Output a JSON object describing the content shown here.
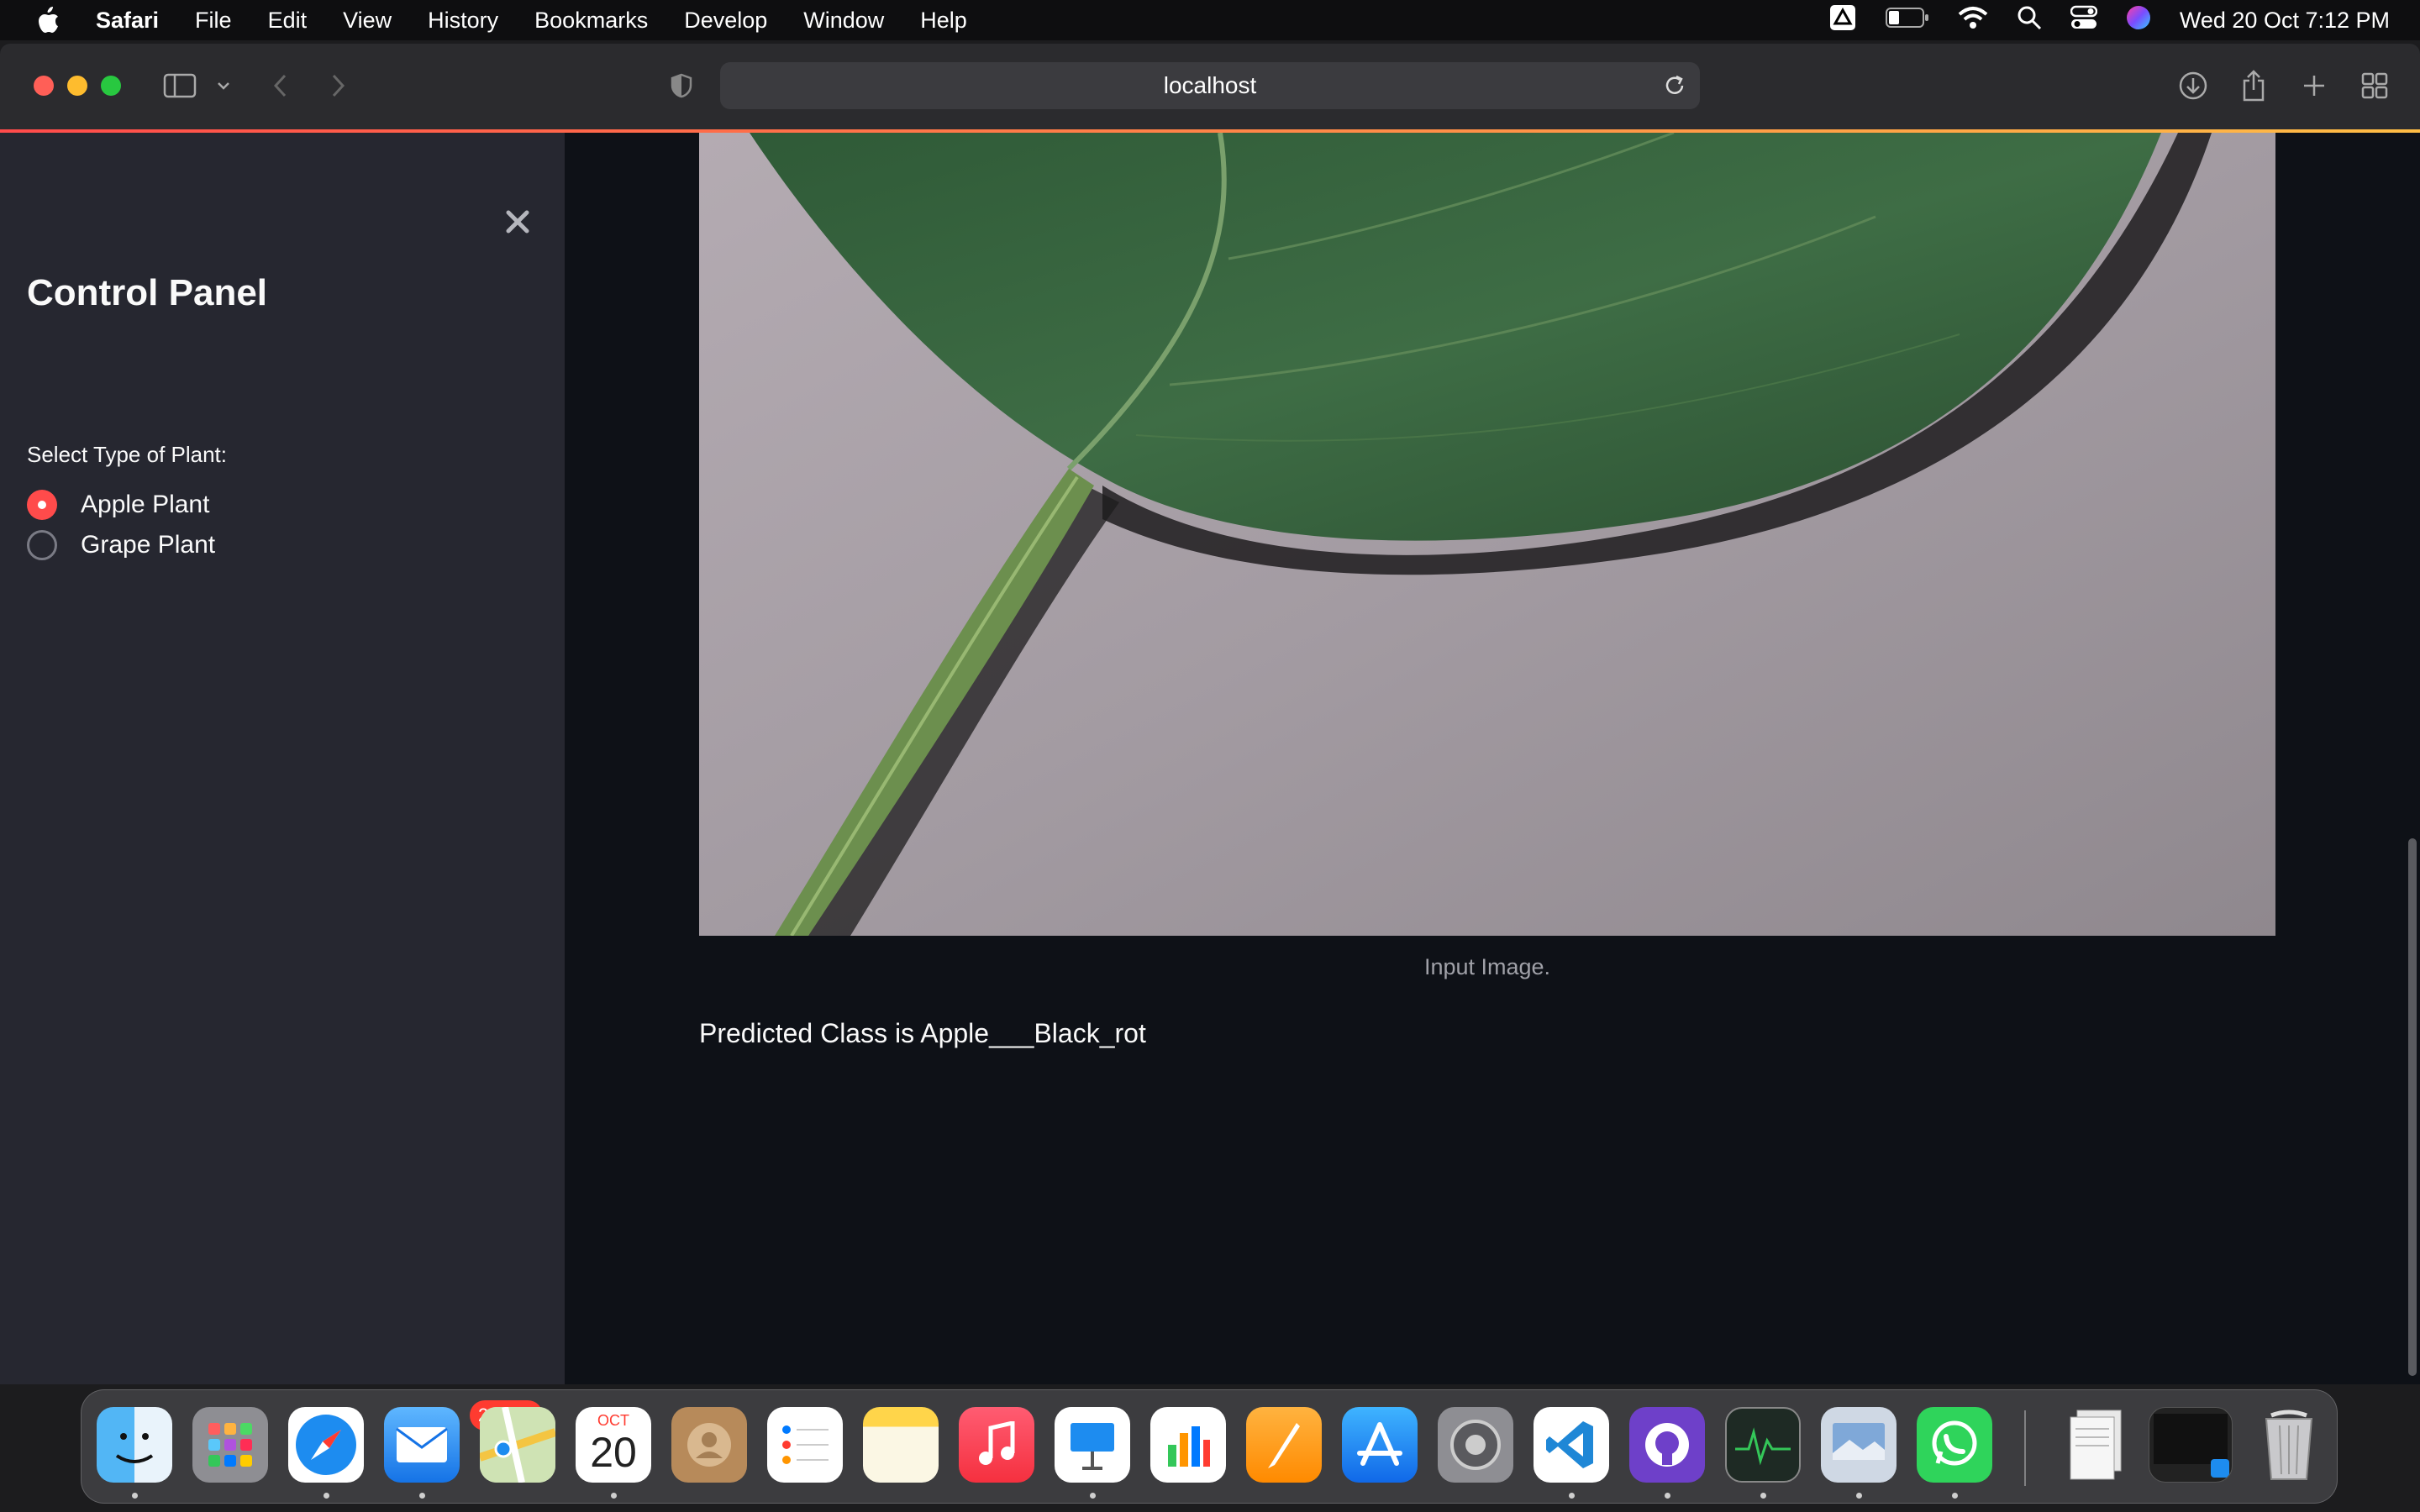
{
  "menubar": {
    "app_name": "Safari",
    "menus": [
      "File",
      "Edit",
      "View",
      "History",
      "Bookmarks",
      "Develop",
      "Window",
      "Help"
    ],
    "clock": "Wed 20 Oct  7:12 PM",
    "status_icons": [
      "drive-icon",
      "battery-icon",
      "wifi-icon",
      "spotlight-icon",
      "control-center-icon",
      "siri-icon"
    ]
  },
  "browser": {
    "address": "localhost"
  },
  "sidebar": {
    "title": "Control Panel",
    "radio_label": "Select Type of Plant:",
    "options": [
      {
        "label": "Apple Plant",
        "selected": true
      },
      {
        "label": "Grape Plant",
        "selected": false
      }
    ],
    "accent_color": "#ff4b4b"
  },
  "main": {
    "image_caption": "Input Image.",
    "prediction": "Predicted Class is Apple___Black_rot"
  },
  "dock": {
    "mail_badge": "20,917",
    "calendar_month": "OCT",
    "calendar_day": "20",
    "apps": [
      "Finder",
      "Launchpad",
      "Safari",
      "Mail",
      "Maps",
      "Calendar",
      "Contacts",
      "Reminders",
      "Notes",
      "Music",
      "Keynote",
      "Numbers",
      "Pages",
      "App Store",
      "System Preferences",
      "Visual Studio Code",
      "GitHub Desktop",
      "Activity Monitor",
      "Preview",
      "WhatsApp",
      "Documents",
      "Screenshot",
      "Trash"
    ]
  }
}
